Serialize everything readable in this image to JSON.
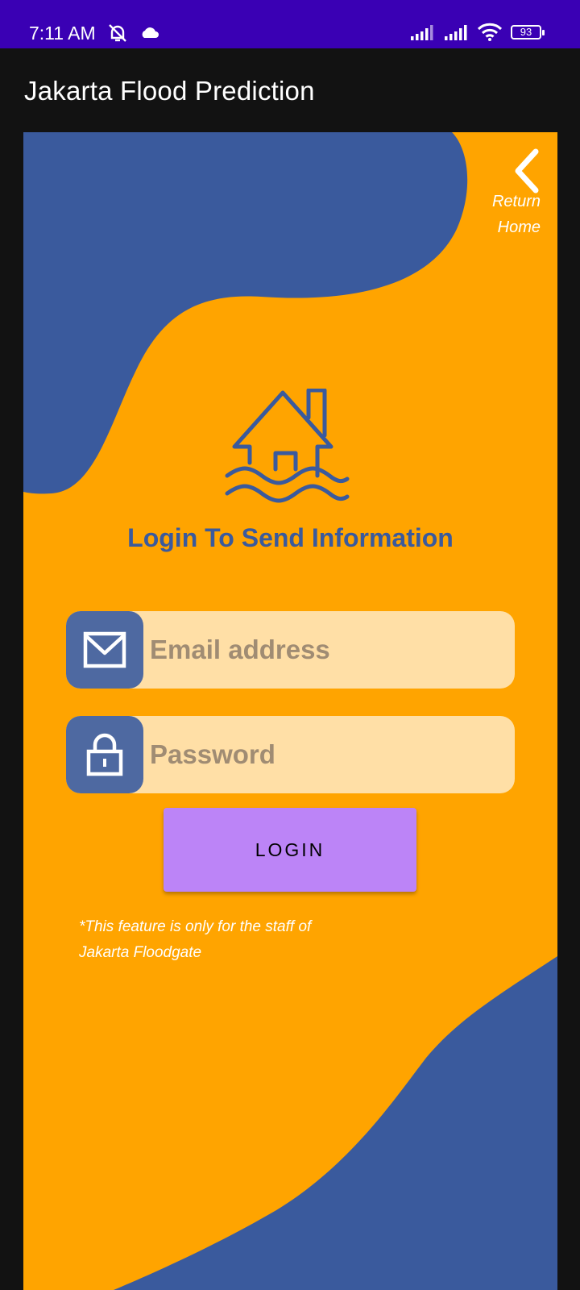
{
  "status_bar": {
    "time": "7:11 AM",
    "icons": [
      "silent-bell-icon",
      "cloud-icon",
      "signal-icon",
      "signal-icon",
      "wifi-icon"
    ],
    "battery": "93"
  },
  "app_bar": {
    "title": "Jakarta Flood Prediction"
  },
  "card": {
    "return_label": "Return Home",
    "heading": "Login To Send Information",
    "email": {
      "placeholder": "Email address",
      "value": "",
      "icon": "mail-icon"
    },
    "password": {
      "placeholder": "Password",
      "value": "",
      "icon": "lock-icon"
    },
    "login_label": "LOGIN",
    "note": "*This feature is only for the staff of Jakarta Floodgate"
  },
  "colors": {
    "status_bar": "#3a00b4",
    "app_bar": "#121212",
    "card_background": "#ffa400",
    "wave_blue": "#3a5a9d",
    "field_background": "#ffdfa6",
    "field_icon_background": "#4e69a1",
    "login_button": "#bc84f7"
  }
}
